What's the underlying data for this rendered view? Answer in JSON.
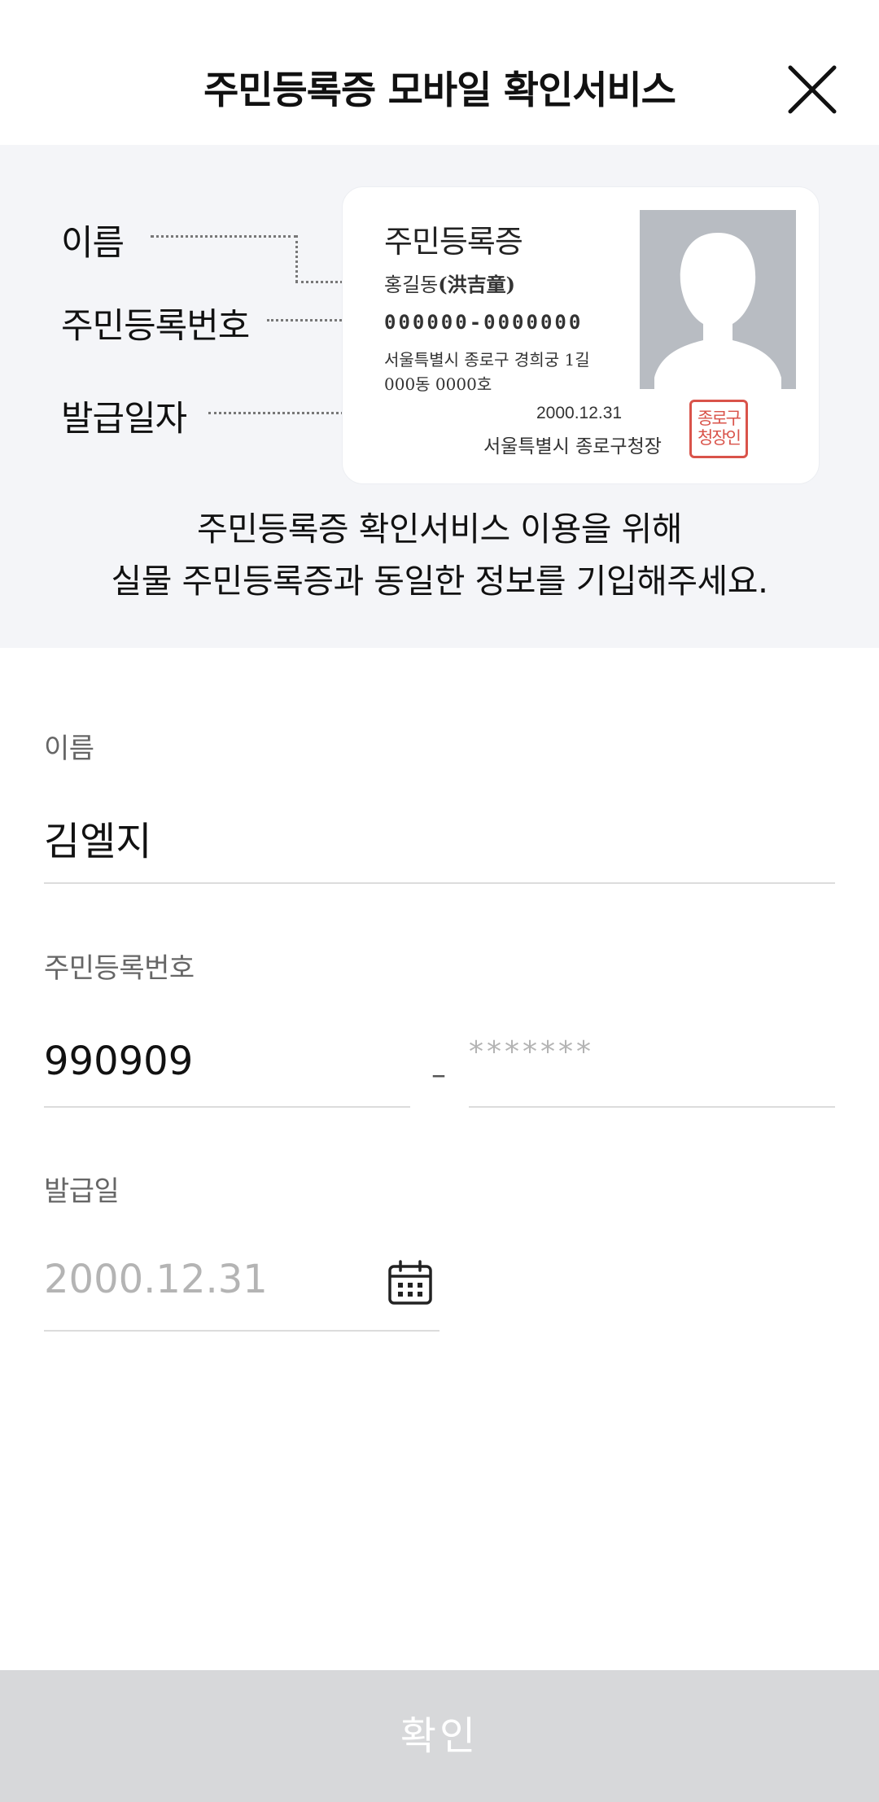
{
  "header": {
    "title": "주민등록증 모바일 확인서비스",
    "close_icon": "close-icon"
  },
  "guide": {
    "labels": {
      "name": "이름",
      "rrn": "주민등록번호",
      "issue_date": "발급일자"
    },
    "card": {
      "title": "주민등록증",
      "name_korean": "홍길동",
      "name_hanja": "(洪吉童)",
      "rrn": "000000-0000000",
      "address_line1": "서울특별시 종로구 경희궁 1길",
      "address_line2": "000동 0000호",
      "issue_date": "2000.12.31",
      "issuer": "서울특별시 종로구청장",
      "seal_line1": "종로구",
      "seal_line2": "청장인",
      "seal_color": "#d9534a",
      "photo_icon": "person-silhouette-icon"
    },
    "description_line1": "주민등록증 확인서비스 이용을 위해",
    "description_line2": "실물 주민등록증과 동일한 정보를 기입해주세요."
  },
  "form": {
    "name": {
      "label": "이름",
      "value": "김엘지"
    },
    "rrn": {
      "label": "주민등록번호",
      "front_value": "990909",
      "separator": "–",
      "back_placeholder": "*******"
    },
    "issue_date": {
      "label": "발급일",
      "placeholder": "2000.12.31",
      "icon": "calendar-icon"
    }
  },
  "confirm_button": {
    "label": "확인",
    "background": "#d7d8da"
  }
}
